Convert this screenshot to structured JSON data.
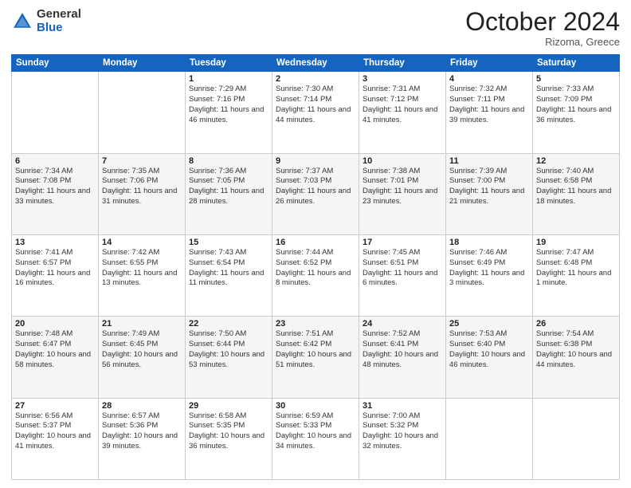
{
  "header": {
    "logo": {
      "line1": "General",
      "line2": "Blue"
    },
    "title": "October 2024",
    "subtitle": "Rizoma, Greece"
  },
  "weekdays": [
    "Sunday",
    "Monday",
    "Tuesday",
    "Wednesday",
    "Thursday",
    "Friday",
    "Saturday"
  ],
  "weeks": [
    [
      {
        "day": "",
        "info": ""
      },
      {
        "day": "",
        "info": ""
      },
      {
        "day": "1",
        "info": "Sunrise: 7:29 AM\nSunset: 7:16 PM\nDaylight: 11 hours and 46 minutes."
      },
      {
        "day": "2",
        "info": "Sunrise: 7:30 AM\nSunset: 7:14 PM\nDaylight: 11 hours and 44 minutes."
      },
      {
        "day": "3",
        "info": "Sunrise: 7:31 AM\nSunset: 7:12 PM\nDaylight: 11 hours and 41 minutes."
      },
      {
        "day": "4",
        "info": "Sunrise: 7:32 AM\nSunset: 7:11 PM\nDaylight: 11 hours and 39 minutes."
      },
      {
        "day": "5",
        "info": "Sunrise: 7:33 AM\nSunset: 7:09 PM\nDaylight: 11 hours and 36 minutes."
      }
    ],
    [
      {
        "day": "6",
        "info": "Sunrise: 7:34 AM\nSunset: 7:08 PM\nDaylight: 11 hours and 33 minutes."
      },
      {
        "day": "7",
        "info": "Sunrise: 7:35 AM\nSunset: 7:06 PM\nDaylight: 11 hours and 31 minutes."
      },
      {
        "day": "8",
        "info": "Sunrise: 7:36 AM\nSunset: 7:05 PM\nDaylight: 11 hours and 28 minutes."
      },
      {
        "day": "9",
        "info": "Sunrise: 7:37 AM\nSunset: 7:03 PM\nDaylight: 11 hours and 26 minutes."
      },
      {
        "day": "10",
        "info": "Sunrise: 7:38 AM\nSunset: 7:01 PM\nDaylight: 11 hours and 23 minutes."
      },
      {
        "day": "11",
        "info": "Sunrise: 7:39 AM\nSunset: 7:00 PM\nDaylight: 11 hours and 21 minutes."
      },
      {
        "day": "12",
        "info": "Sunrise: 7:40 AM\nSunset: 6:58 PM\nDaylight: 11 hours and 18 minutes."
      }
    ],
    [
      {
        "day": "13",
        "info": "Sunrise: 7:41 AM\nSunset: 6:57 PM\nDaylight: 11 hours and 16 minutes."
      },
      {
        "day": "14",
        "info": "Sunrise: 7:42 AM\nSunset: 6:55 PM\nDaylight: 11 hours and 13 minutes."
      },
      {
        "day": "15",
        "info": "Sunrise: 7:43 AM\nSunset: 6:54 PM\nDaylight: 11 hours and 11 minutes."
      },
      {
        "day": "16",
        "info": "Sunrise: 7:44 AM\nSunset: 6:52 PM\nDaylight: 11 hours and 8 minutes."
      },
      {
        "day": "17",
        "info": "Sunrise: 7:45 AM\nSunset: 6:51 PM\nDaylight: 11 hours and 6 minutes."
      },
      {
        "day": "18",
        "info": "Sunrise: 7:46 AM\nSunset: 6:49 PM\nDaylight: 11 hours and 3 minutes."
      },
      {
        "day": "19",
        "info": "Sunrise: 7:47 AM\nSunset: 6:48 PM\nDaylight: 11 hours and 1 minute."
      }
    ],
    [
      {
        "day": "20",
        "info": "Sunrise: 7:48 AM\nSunset: 6:47 PM\nDaylight: 10 hours and 58 minutes."
      },
      {
        "day": "21",
        "info": "Sunrise: 7:49 AM\nSunset: 6:45 PM\nDaylight: 10 hours and 56 minutes."
      },
      {
        "day": "22",
        "info": "Sunrise: 7:50 AM\nSunset: 6:44 PM\nDaylight: 10 hours and 53 minutes."
      },
      {
        "day": "23",
        "info": "Sunrise: 7:51 AM\nSunset: 6:42 PM\nDaylight: 10 hours and 51 minutes."
      },
      {
        "day": "24",
        "info": "Sunrise: 7:52 AM\nSunset: 6:41 PM\nDaylight: 10 hours and 48 minutes."
      },
      {
        "day": "25",
        "info": "Sunrise: 7:53 AM\nSunset: 6:40 PM\nDaylight: 10 hours and 46 minutes."
      },
      {
        "day": "26",
        "info": "Sunrise: 7:54 AM\nSunset: 6:38 PM\nDaylight: 10 hours and 44 minutes."
      }
    ],
    [
      {
        "day": "27",
        "info": "Sunrise: 6:56 AM\nSunset: 5:37 PM\nDaylight: 10 hours and 41 minutes."
      },
      {
        "day": "28",
        "info": "Sunrise: 6:57 AM\nSunset: 5:36 PM\nDaylight: 10 hours and 39 minutes."
      },
      {
        "day": "29",
        "info": "Sunrise: 6:58 AM\nSunset: 5:35 PM\nDaylight: 10 hours and 36 minutes."
      },
      {
        "day": "30",
        "info": "Sunrise: 6:59 AM\nSunset: 5:33 PM\nDaylight: 10 hours and 34 minutes."
      },
      {
        "day": "31",
        "info": "Sunrise: 7:00 AM\nSunset: 5:32 PM\nDaylight: 10 hours and 32 minutes."
      },
      {
        "day": "",
        "info": ""
      },
      {
        "day": "",
        "info": ""
      }
    ]
  ]
}
